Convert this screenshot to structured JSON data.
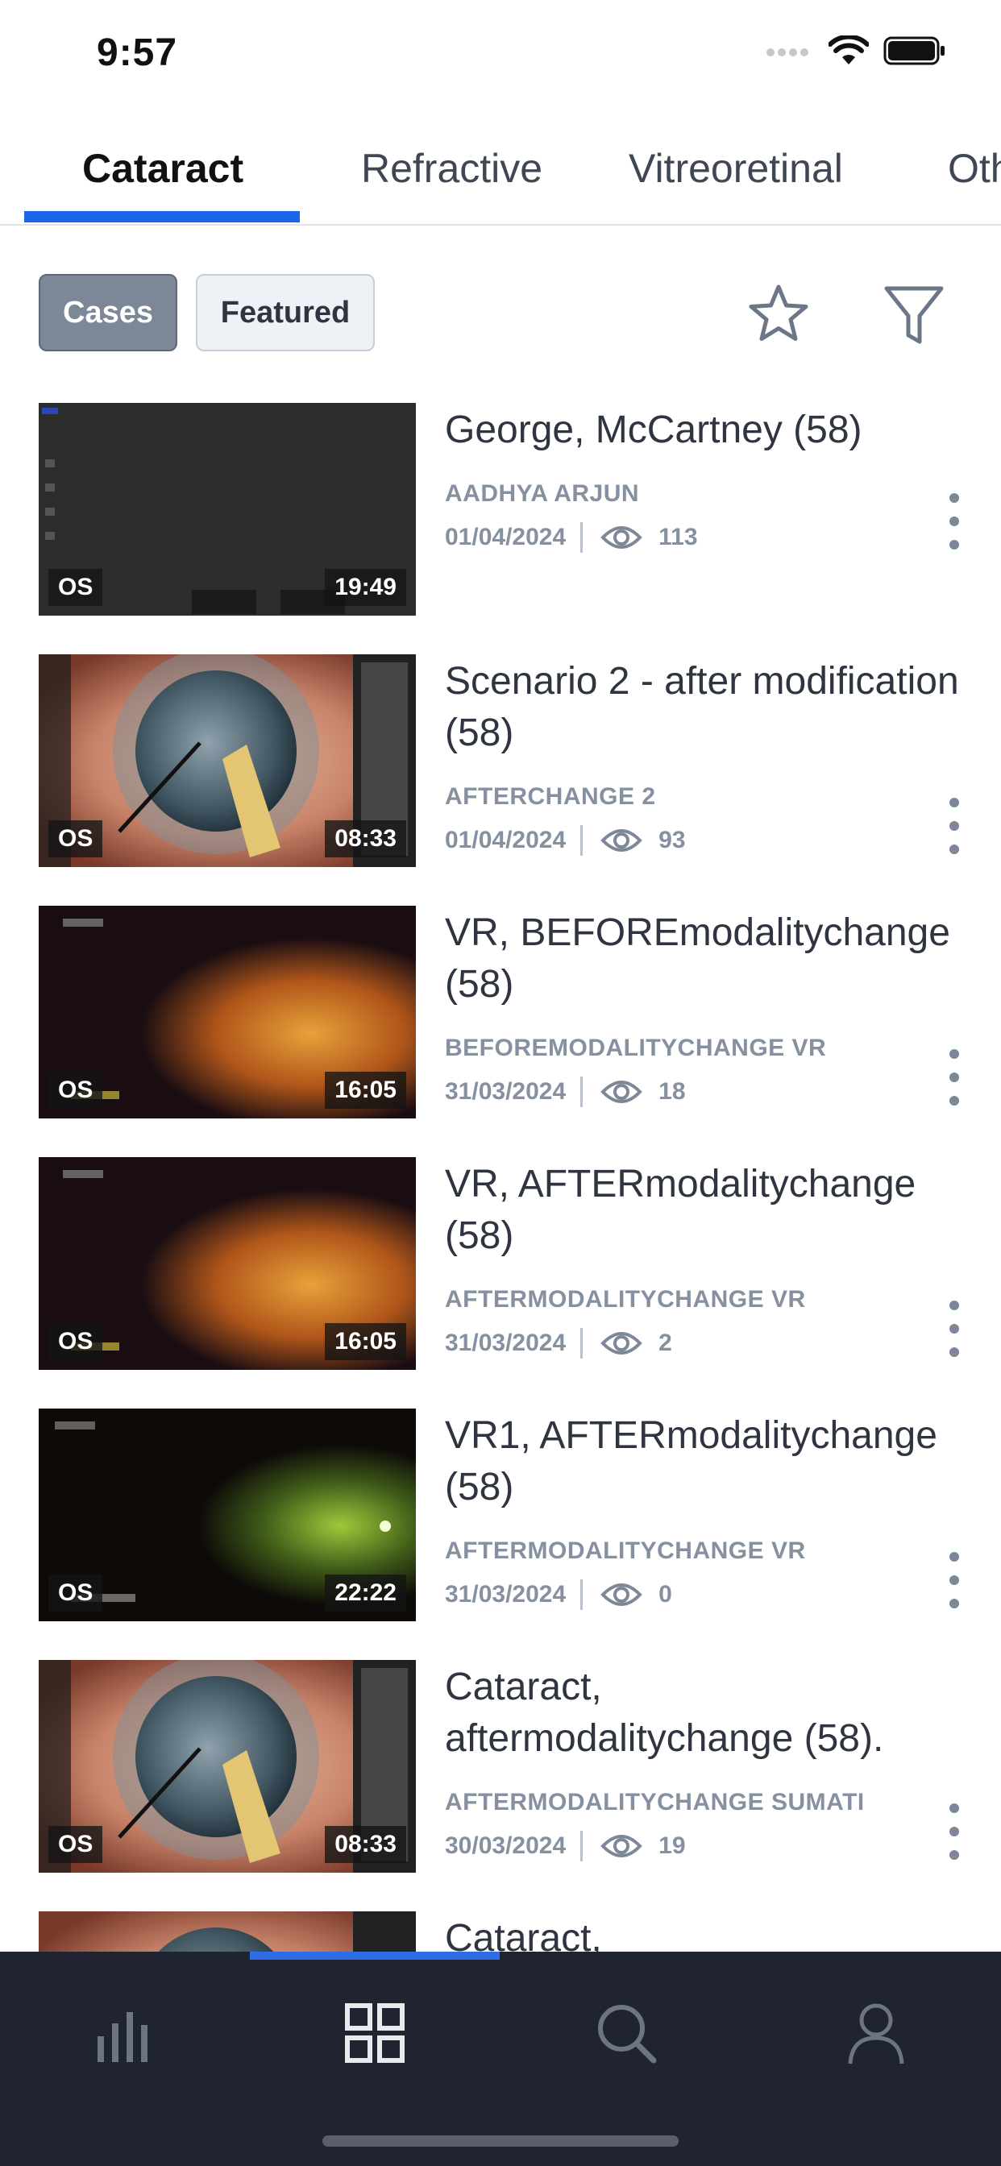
{
  "status_bar": {
    "time": "9:57"
  },
  "tabs": [
    {
      "label": "Cataract",
      "active": true
    },
    {
      "label": "Refractive",
      "active": false
    },
    {
      "label": "Vitreoretinal",
      "active": false
    },
    {
      "label": "Other",
      "active": false
    }
  ],
  "filters": {
    "cases_label": "Cases",
    "featured_label": "Featured",
    "selected": "Cases"
  },
  "cases": [
    {
      "title": "George, McCartney (58)",
      "author": "AADHYA ARJUN",
      "date": "01/04/2024",
      "views": "113",
      "eye": "OS",
      "duration": "19:49",
      "thumb": "dark-microscope"
    },
    {
      "title": "Scenario 2 - after modification (58)",
      "author": "AFTERCHANGE 2",
      "date": "01/04/2024",
      "views": "93",
      "eye": "OS",
      "duration": "08:33",
      "thumb": "anterior-eye"
    },
    {
      "title": "VR, BEFOREmodalitychange (58)",
      "author": "BEFOREMODALITYCHANGE VR",
      "date": "31/03/2024",
      "views": "18",
      "eye": "OS",
      "duration": "16:05",
      "thumb": "retina-orange"
    },
    {
      "title": "VR, AFTERmodalitychange (58)",
      "author": "AFTERMODALITYCHANGE VR",
      "date": "31/03/2024",
      "views": "2",
      "eye": "OS",
      "duration": "16:05",
      "thumb": "retina-orange"
    },
    {
      "title": "VR1, AFTERmodalitychange (58)",
      "author": "AFTERMODALITYCHANGE VR",
      "date": "31/03/2024",
      "views": "0",
      "eye": "OS",
      "duration": "22:22",
      "thumb": "retina-green"
    },
    {
      "title": "Cataract, aftermodalitychange (58).",
      "author": "AFTERMODALITYCHANGE SUMATI",
      "date": "30/03/2024",
      "views": "19",
      "eye": "OS",
      "duration": "08:33",
      "thumb": "anterior-eye"
    },
    {
      "title": "Cataract,",
      "author": "",
      "date": "",
      "views": "",
      "eye": "",
      "duration": "",
      "thumb": "anterior-eye"
    }
  ],
  "bottom_nav": [
    {
      "icon": "stats-icon",
      "active": false
    },
    {
      "icon": "grid-icon",
      "active": true
    },
    {
      "icon": "search-icon",
      "active": false
    },
    {
      "icon": "profile-icon",
      "active": false
    }
  ],
  "colors": {
    "accent": "#1a66e8",
    "nav_bg": "#1f2430",
    "muted": "#8590a0"
  }
}
